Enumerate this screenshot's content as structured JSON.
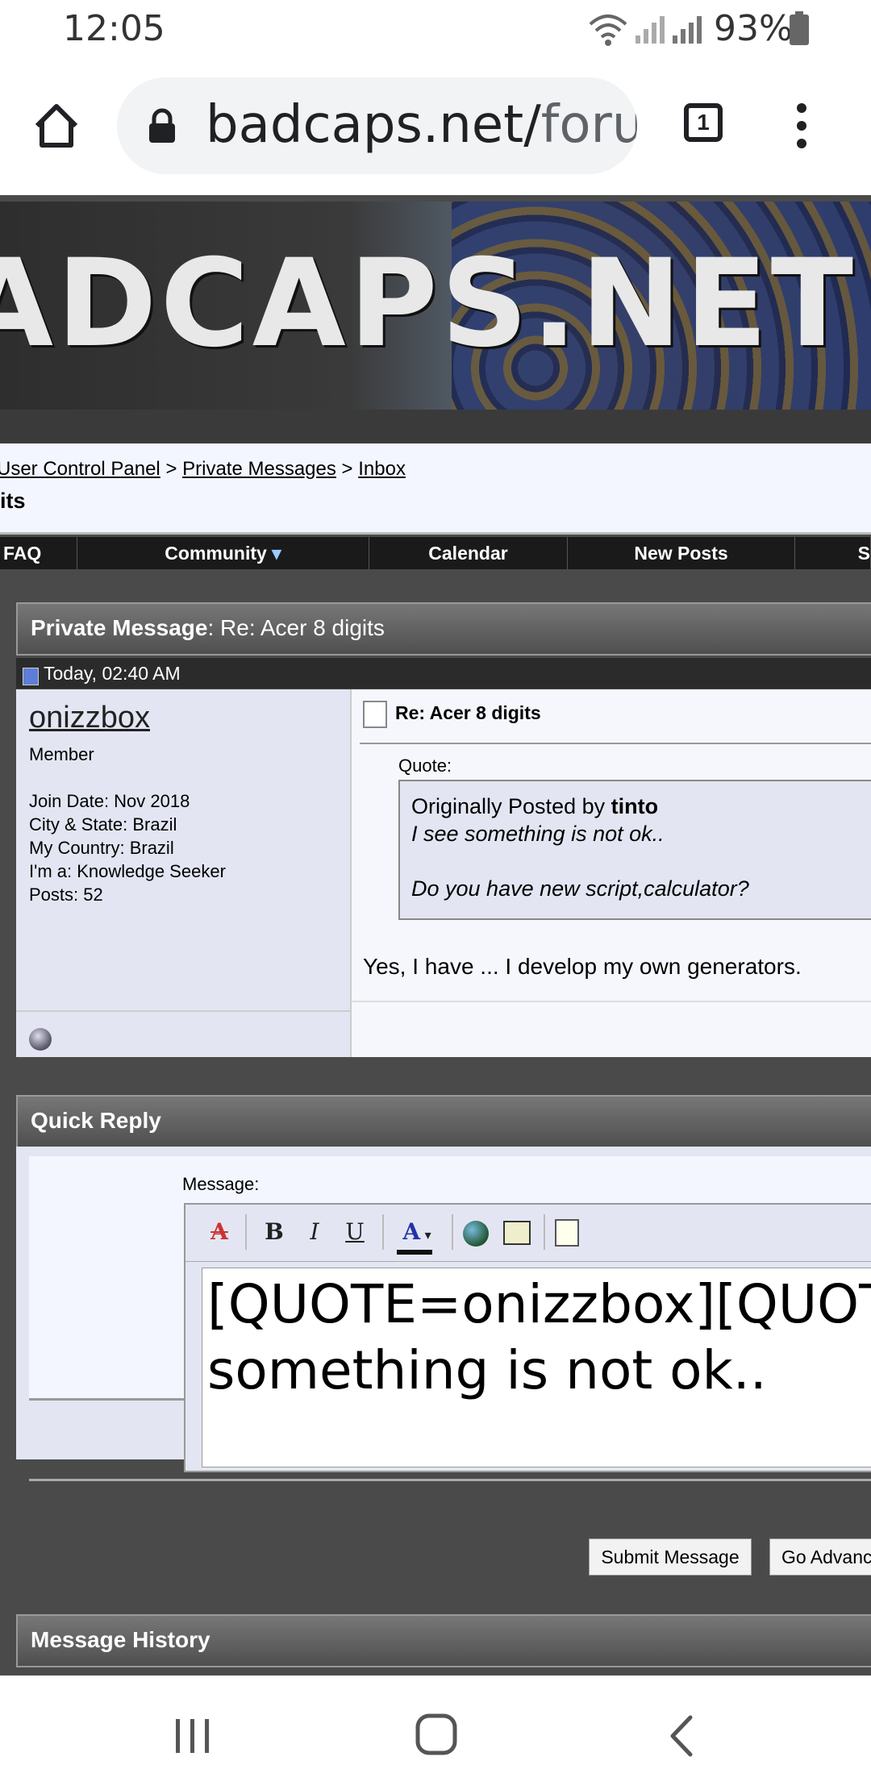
{
  "status_bar": {
    "time": "12:05",
    "battery": "93%"
  },
  "browser": {
    "url_main": "badcaps.net/",
    "url_rest": "forum",
    "tab_count": "1"
  },
  "banner": {
    "text": "ADCAPS.NET"
  },
  "breadcrumb": {
    "items": [
      "User Control Panel",
      "Private Messages",
      "Inbox"
    ],
    "separator": ">",
    "title": "its"
  },
  "menu": [
    "FAQ",
    "Community",
    "Calendar",
    "New Posts",
    "S"
  ],
  "pm": {
    "header_label": "Private Message",
    "header_subject": "Re: Acer 8 digits",
    "date": "Today, 02:40 AM",
    "user": {
      "name": "onizzbox",
      "title": "Member",
      "join_date": "Join Date: Nov 2018",
      "city": "City & State: Brazil",
      "country": "My Country: Brazil",
      "role": "I'm a: Knowledge Seeker",
      "posts": "Posts: 52"
    },
    "post_title": "Re: Acer 8 digits",
    "quote_label": "Quote:",
    "quote_by_prefix": "Originally Posted by ",
    "quote_author": "tinto",
    "quote_line1": "I see something is not ok..",
    "quote_line2": "Do you have new script,calculator?",
    "body": "Yes, I have ... I develop my own generators."
  },
  "quick_reply": {
    "header": "Quick Reply",
    "message_label": "Message:",
    "textarea_value": "[QUOTE=onizzbox][QUOTE=\nsomething is not ok..\n\nDo you have new script,calcu",
    "submit": "Submit Message",
    "advanced": "Go Advanced"
  },
  "history": {
    "header": "Message History"
  },
  "icons": [
    "home-icon",
    "lock-icon",
    "tabs-icon",
    "more-icon",
    "wifi-icon",
    "signal-icon",
    "battery-icon",
    "recents-icon",
    "home-nav-icon",
    "back-icon"
  ]
}
